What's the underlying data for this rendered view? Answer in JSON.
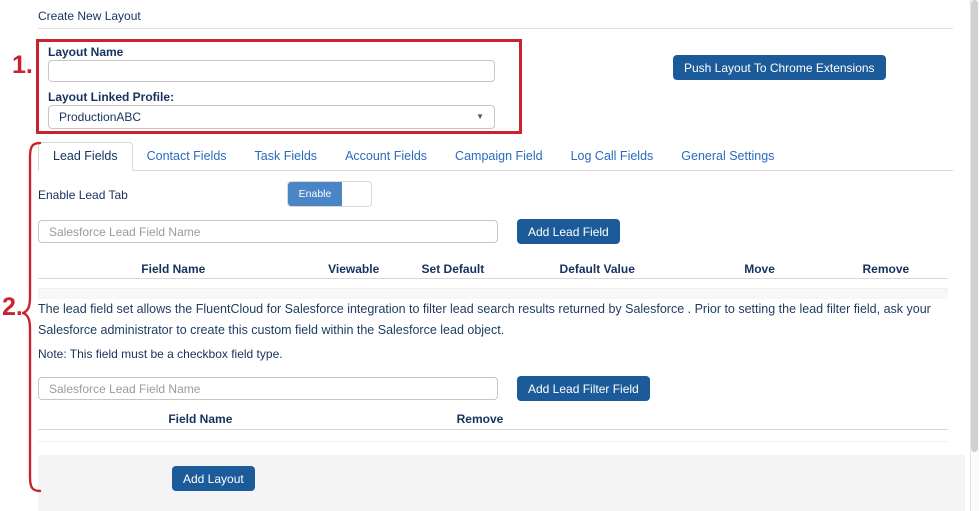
{
  "page": {
    "title": "Create New Layout"
  },
  "annotations": {
    "one": "1.",
    "two": "2."
  },
  "layout_form": {
    "name_label": "Layout Name",
    "name_value": "",
    "profile_label": "Layout Linked Profile:",
    "profile_value": "ProductionABC",
    "push_button": "Push Layout To Chrome Extensions"
  },
  "tabs": {
    "active_tab": "Lead Fields",
    "items": [
      "Lead Fields",
      "Contact Fields",
      "Task Fields",
      "Account Fields",
      "Campaign Field",
      "Log Call Fields",
      "General Settings"
    ]
  },
  "lead_tab": {
    "enable_label": "Enable Lead Tab",
    "toggle_on_label": "Enable",
    "field_input_placeholder": "Salesforce Lead Field Name",
    "add_field_button": "Add Lead Field",
    "fields_table_headers": [
      "Field Name",
      "Viewable",
      "Set Default",
      "Default Value",
      "Move",
      "Remove"
    ],
    "filter_description": "The lead field set allows the FluentCloud for Salesforce integration to filter lead search results returned by Salesforce . Prior to setting the lead filter field, ask your Salesforce administrator to create this custom field within the Salesforce lead object.",
    "filter_note": "Note: This field must be a checkbox field type.",
    "filter_input_placeholder": "Salesforce Lead Field Name",
    "add_filter_button": "Add Lead Filter Field",
    "filter_table_headers": [
      "Field Name",
      "Remove"
    ],
    "add_layout_button": "Add Layout"
  },
  "colors": {
    "accent_navy_button": "#1c5b99",
    "toggle_blue": "#4a86c5",
    "link_blue": "#2a6bbd",
    "annotation_red": "#c9242b",
    "text_navy": "#16325c"
  }
}
